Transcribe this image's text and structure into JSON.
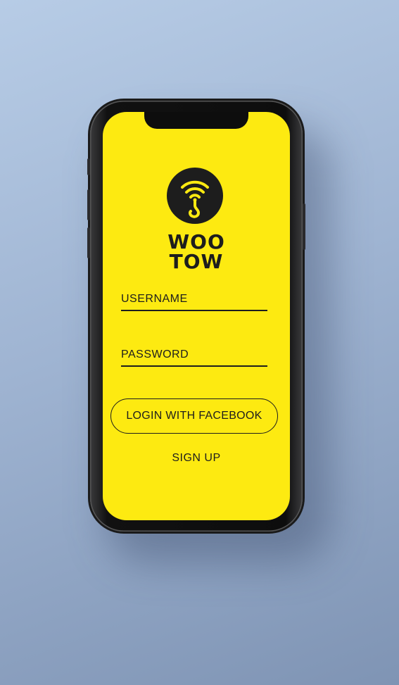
{
  "app": {
    "brand_line1": "WOO",
    "brand_line2": "TOW",
    "logo_icon": "wifi-tow-hook-icon"
  },
  "login_form": {
    "username_label": "USERNAME",
    "password_label": "PASSWORD",
    "facebook_button_label": "LOGIN WITH FACEBOOK",
    "signup_label": "SIGN UP"
  },
  "colors": {
    "screen_background": "#fdea11",
    "ink": "#1d1d1d",
    "page_background": "#9fb4d2"
  }
}
